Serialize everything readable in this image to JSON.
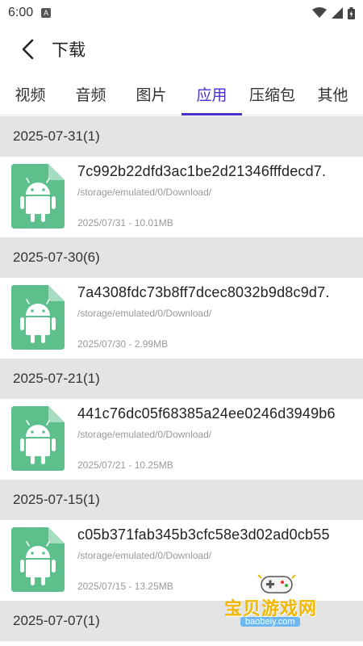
{
  "status_bar": {
    "time": "6:00",
    "app_icon": "A"
  },
  "app_bar": {
    "title": "下载"
  },
  "tabs": [
    {
      "label": "视频",
      "active": false
    },
    {
      "label": "音频",
      "active": false
    },
    {
      "label": "图片",
      "active": false
    },
    {
      "label": "应用",
      "active": true
    },
    {
      "label": "压缩包",
      "active": false
    },
    {
      "label": "其他",
      "active": false
    }
  ],
  "groups": [
    {
      "header": "2025-07-31(1)",
      "item": {
        "name": "7c992b22dfd3ac1be2d21346fffdecd7.",
        "path": "/storage/emulated/0/Download/",
        "meta": "2025/07/31 - 10.01MB"
      }
    },
    {
      "header": "2025-07-30(6)",
      "item": {
        "name": "7a4308fdc73b8ff7dcec8032b9d8c9d7.",
        "path": "/storage/emulated/0/Download/",
        "meta": "2025/07/30 - 2.99MB"
      }
    },
    {
      "header": "2025-07-21(1)",
      "item": {
        "name": "441c76dc05f68385a24ee0246d3949b6",
        "path": "/storage/emulated/0/Download/",
        "meta": "2025/07/21 - 10.25MB"
      }
    },
    {
      "header": "2025-07-15(1)",
      "item": {
        "name": "c05b371fab345b3cfc58e3d02ad0cb55",
        "path": "/storage/emulated/0/Download/",
        "meta": "2025/07/15 - 13.25MB"
      }
    },
    {
      "header": "2025-07-07(1)"
    }
  ],
  "watermark": {
    "text": "宝贝游戏网",
    "url": "baobeiy.com"
  },
  "colors": {
    "accent": "#4a2fd1",
    "file_icon": "#5dbf8c",
    "group_bg": "#e4e4e4"
  },
  "icons": {
    "back": "chevron-left-icon",
    "file": "android-apk-file-icon"
  }
}
